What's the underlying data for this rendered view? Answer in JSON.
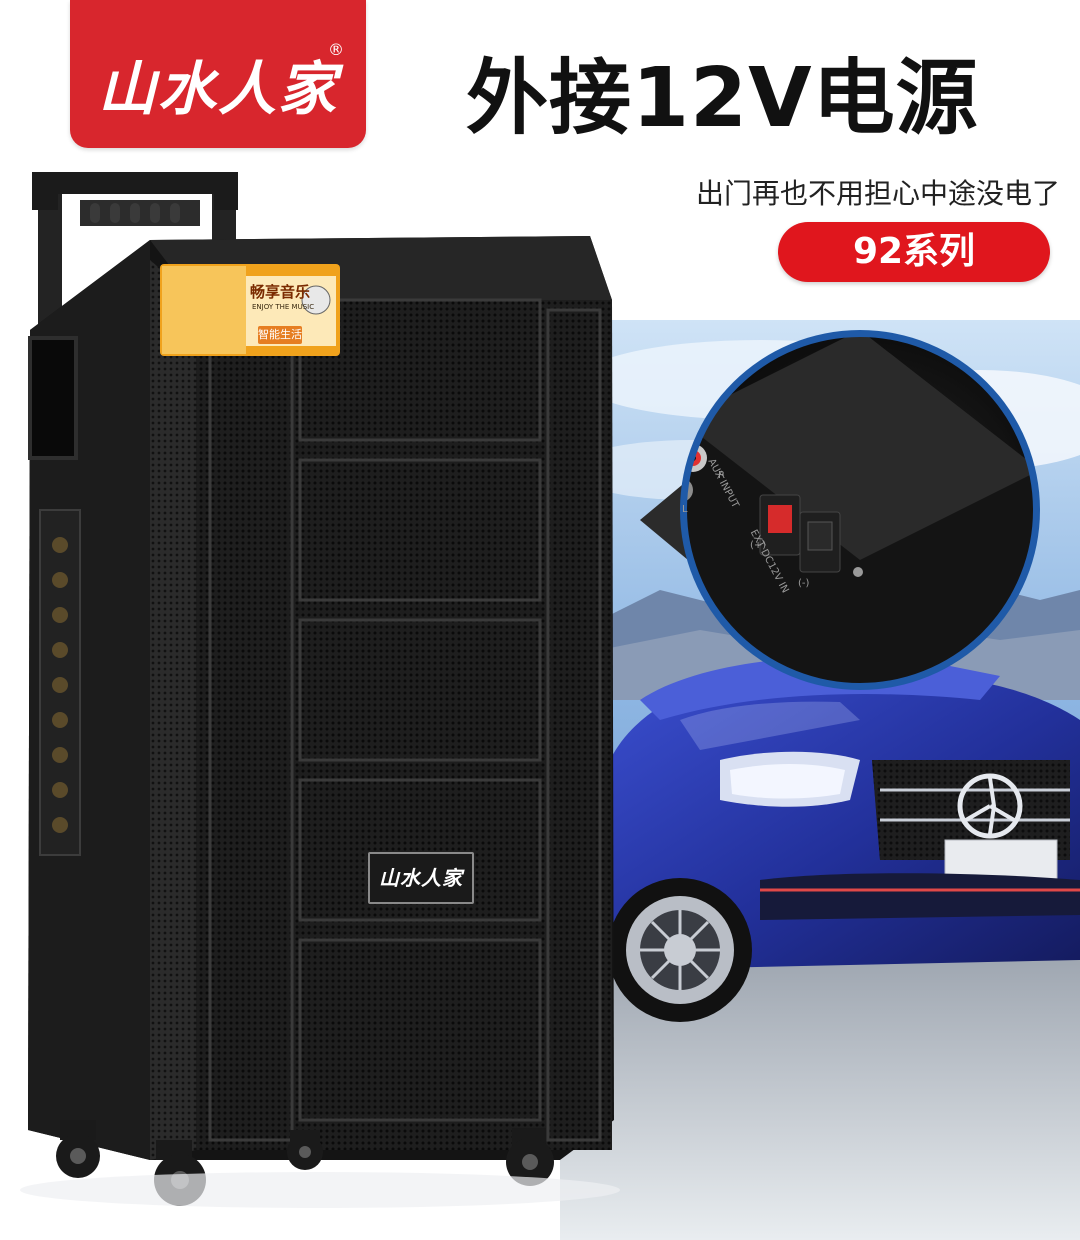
{
  "brand": {
    "logo_text": "山水人家",
    "registered_mark": "®"
  },
  "headline": "外接12V电源",
  "subheadline": "出门再也不用担心中途没电了",
  "series_badge": "92系列",
  "speaker": {
    "grille_logo": "山水人家",
    "sticker": {
      "title": "畅享音乐",
      "subtitle": "ENJOY THE MUSIC",
      "badge": "智能生活"
    }
  },
  "inset_panel": {
    "labels": {
      "input": "AUX INPUT",
      "ext": "EXT DC12V IN",
      "plus": "(+)",
      "minus": "(-)",
      "r": "R",
      "l": "L"
    }
  },
  "colors": {
    "brand_red": "#d8262d",
    "pill_red": "#e0161d",
    "car_blue": "#2f3fb0"
  }
}
